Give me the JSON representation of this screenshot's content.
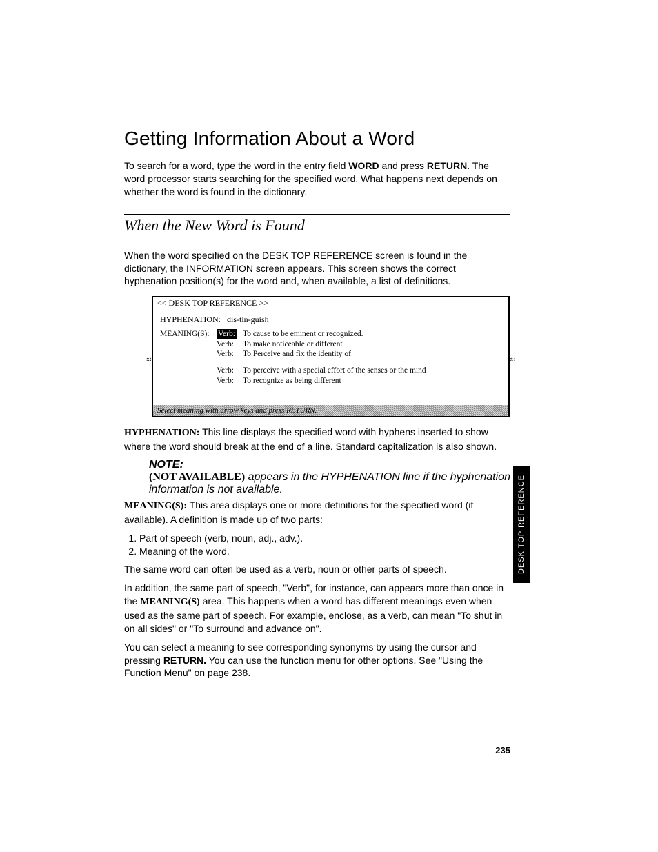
{
  "title": "Getting Information About a Word",
  "intro1a": "To search for a word, type the word in the entry field ",
  "intro1b": "WORD",
  "intro1c": " and press ",
  "intro1d": "RETURN",
  "intro1e": ". The word processor starts searching for the specified word. What happens next depends on whether the word is found in the dictionary.",
  "subhead": "When the New Word is Found",
  "found_p": "When the word specified on the DESK TOP REFERENCE screen is found in the dictionary, the INFORMATION screen appears. This screen shows the correct hyphenation position(s) for the word and, when available, a list of definitions.",
  "screen": {
    "title": "<< DESK TOP REFERENCE >>",
    "hy_label": "HYPHENATION:",
    "hy_value": "dis-tin-guish",
    "meanings_label": "MEANING(S):",
    "rows": [
      {
        "pos": "Verb:",
        "text": "To cause to be eminent or recognized.",
        "sel": true
      },
      {
        "pos": "Verb:",
        "text": "To make noticeable or different",
        "sel": false
      },
      {
        "pos": "Verb:",
        "text": "To Perceive and fix the identity of",
        "sel": false
      }
    ],
    "rows2": [
      {
        "pos": "Verb:",
        "text": "To perceive with a special effort of the senses or the mind"
      },
      {
        "pos": "Verb:",
        "text": "To recognize as being different"
      }
    ],
    "footer": "Select meaning with arrow keys and press RETURN."
  },
  "hyph_term": "HYPHENATION:",
  "hyph_body": " This line displays the specified word with hyphens inserted to show where the word should break at the end of a line. Standard capitalization is also shown.",
  "note_label": "NOTE:",
  "note_bold": "(NOT AVAILABLE)",
  "note_body": " appears in the HYPHENATION line if the hyphenation information is not available.",
  "mean_term": "MEANING(S):",
  "mean_body": " This area displays one or more definitions for the specified word (if available). A definition is made up of two parts:",
  "list": [
    "Part of speech (verb, noun, adj., adv.).",
    "Meaning of the word."
  ],
  "p_same": "The same word can often be used as a verb, noun or other parts of speech.",
  "p_inadd_a": "In addition, the same part of speech, \"Verb\", for instance, can appears more than once in the ",
  "p_inadd_b": "MEANING(S)",
  "p_inadd_c": " area. This happens when a word has different meanings even when used as the same part of speech. For example, enclose, as a verb, can mean \"To shut in on all sides\" or \"To surround and advance on\".",
  "p_sel_a": "You can select a meaning to see corresponding synonyms by using the cursor and pressing ",
  "p_sel_b": "RETURN.",
  "p_sel_c": " You can use the function menu for other options. See \"Using the Function Menu\" on page 238.",
  "tab": "DESK TOP REFERENCE",
  "page_number": "235"
}
